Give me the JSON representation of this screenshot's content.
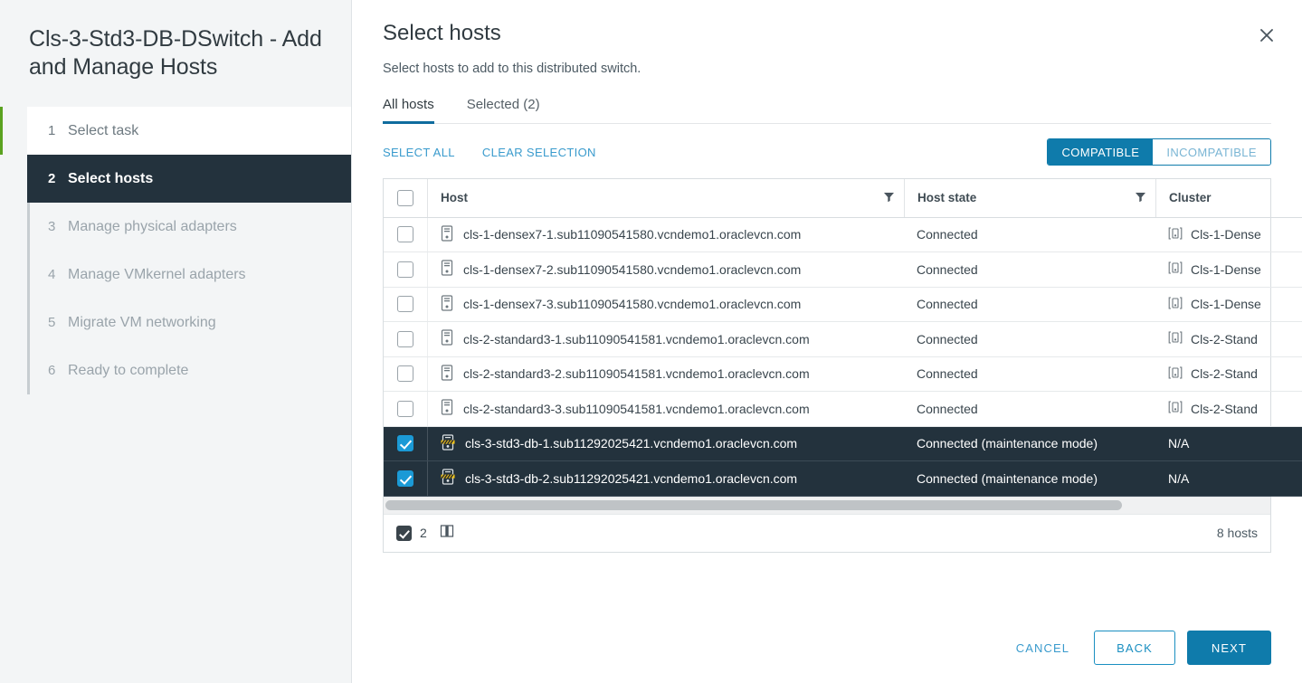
{
  "sidebar": {
    "title": "Cls-3-Std3-DB-DSwitch - Add and Manage Hosts",
    "steps": [
      {
        "num": "1",
        "label": "Select task",
        "state": "done"
      },
      {
        "num": "2",
        "label": "Select hosts",
        "state": "active"
      },
      {
        "num": "3",
        "label": "Manage physical adapters",
        "state": "pending"
      },
      {
        "num": "4",
        "label": "Manage VMkernel adapters",
        "state": "pending"
      },
      {
        "num": "5",
        "label": "Migrate VM networking",
        "state": "pending"
      },
      {
        "num": "6",
        "label": "Ready to complete",
        "state": "pending"
      }
    ]
  },
  "pane": {
    "title": "Select hosts",
    "subtitle": "Select hosts to add to this distributed switch.",
    "close_icon": "close-icon"
  },
  "tabs": [
    {
      "label": "All hosts",
      "selected": true
    },
    {
      "label": "Selected (2)",
      "selected": false
    }
  ],
  "actions": {
    "select_all": "SELECT ALL",
    "clear_selection": "CLEAR SELECTION",
    "compatible": "COMPATIBLE",
    "incompatible": "INCOMPATIBLE",
    "compatible_active": true
  },
  "table": {
    "columns": [
      "Host",
      "Host state",
      "Cluster"
    ],
    "rows": [
      {
        "checked": false,
        "host": "cls-1-densex7-1.sub11090541580.vcndemo1.oraclevcn.com",
        "state": "Connected",
        "cluster": "Cls-1-Dense",
        "cluster_icon": true,
        "maintenance": false
      },
      {
        "checked": false,
        "host": "cls-1-densex7-2.sub11090541580.vcndemo1.oraclevcn.com",
        "state": "Connected",
        "cluster": "Cls-1-Dense",
        "cluster_icon": true,
        "maintenance": false
      },
      {
        "checked": false,
        "host": "cls-1-densex7-3.sub11090541580.vcndemo1.oraclevcn.com",
        "state": "Connected",
        "cluster": "Cls-1-Dense",
        "cluster_icon": true,
        "maintenance": false
      },
      {
        "checked": false,
        "host": "cls-2-standard3-1.sub11090541581.vcndemo1.oraclevcn.com",
        "state": "Connected",
        "cluster": "Cls-2-Stand",
        "cluster_icon": true,
        "maintenance": false
      },
      {
        "checked": false,
        "host": "cls-2-standard3-2.sub11090541581.vcndemo1.oraclevcn.com",
        "state": "Connected",
        "cluster": "Cls-2-Stand",
        "cluster_icon": true,
        "maintenance": false
      },
      {
        "checked": false,
        "host": "cls-2-standard3-3.sub11090541581.vcndemo1.oraclevcn.com",
        "state": "Connected",
        "cluster": "Cls-2-Stand",
        "cluster_icon": true,
        "maintenance": false
      },
      {
        "checked": true,
        "host": "cls-3-std3-db-1.sub11292025421.vcndemo1.oraclevcn.com",
        "state": "Connected (maintenance mode)",
        "cluster": "N/A",
        "cluster_icon": false,
        "maintenance": true
      },
      {
        "checked": true,
        "host": "cls-3-std3-db-2.sub11292025421.vcndemo1.oraclevcn.com",
        "state": "Connected (maintenance mode)",
        "cluster": "N/A",
        "cluster_icon": false,
        "maintenance": true
      }
    ],
    "footer": {
      "selected_count": "2",
      "total": "8 hosts",
      "columns_icon": "columns-icon"
    }
  },
  "footer_buttons": {
    "cancel": "CANCEL",
    "back": "BACK",
    "next": "NEXT"
  },
  "colors": {
    "accent_blue": "#0f7bab",
    "link_blue": "#3a9bcd",
    "active_step_bg": "#23323d",
    "done_step_bar": "#5aa220",
    "checkbox_blue": "#1b9ad6",
    "maintenance_yellow": "#e8b800"
  }
}
